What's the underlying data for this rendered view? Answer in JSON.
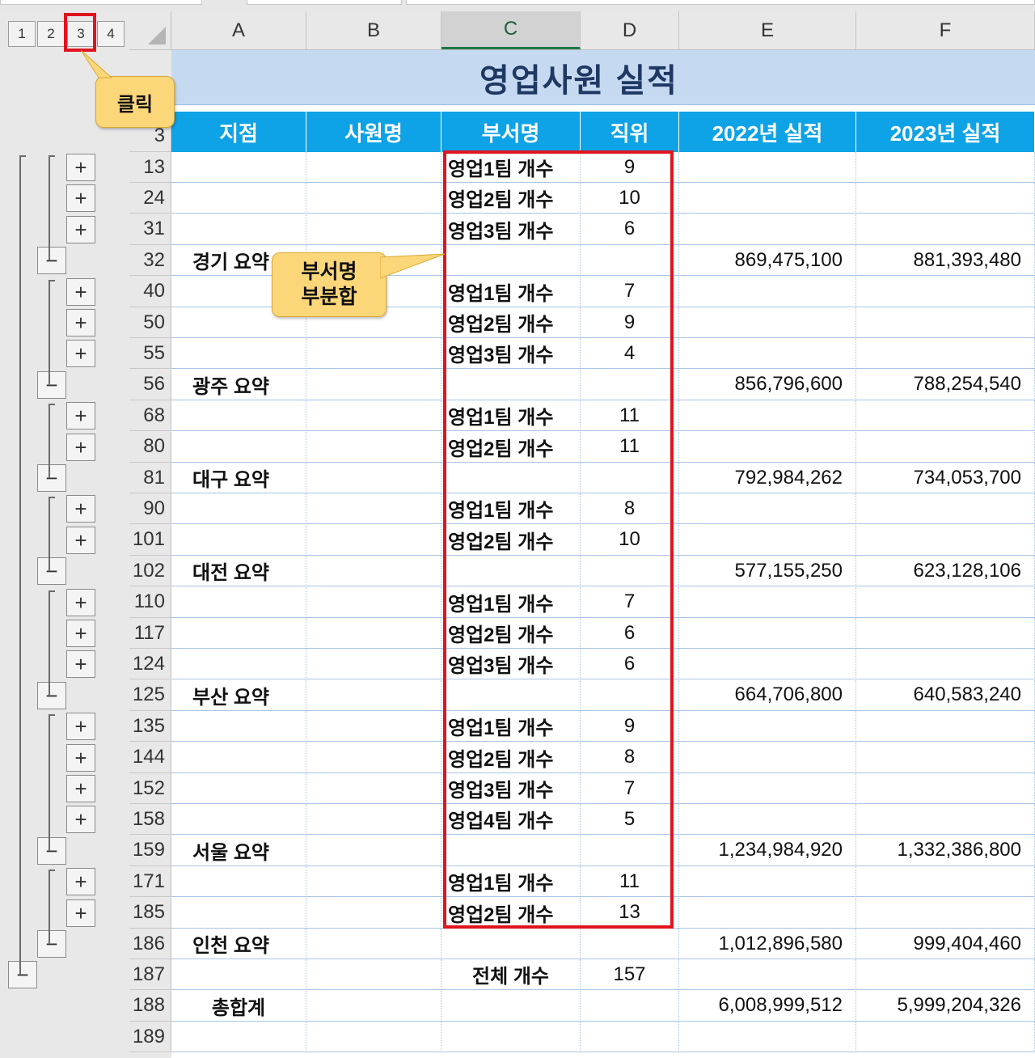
{
  "outline_levels": [
    "1",
    "2",
    "3",
    "4"
  ],
  "columns": [
    "A",
    "B",
    "C",
    "D",
    "E",
    "F"
  ],
  "selected_column": "C",
  "title": "영업사원 실적",
  "headers": [
    "지점",
    "사원명",
    "부서명",
    "직위",
    "2022년 실적",
    "2023년 실적"
  ],
  "callouts": {
    "click_label": "클릭",
    "subtotal_line1": "부서명",
    "subtotal_line2": "부분합"
  },
  "rows": [
    {
      "num": "3",
      "a": "",
      "c": "",
      "d": "",
      "e": "",
      "f": "",
      "type": "header"
    },
    {
      "num": "13",
      "a": "",
      "c": "영업1팀 개수",
      "d": "9",
      "e": "",
      "f": "",
      "type": "team"
    },
    {
      "num": "24",
      "a": "",
      "c": "영업2팀 개수",
      "d": "10",
      "e": "",
      "f": "",
      "type": "team"
    },
    {
      "num": "31",
      "a": "",
      "c": "영업3팀 개수",
      "d": "6",
      "e": "",
      "f": "",
      "type": "team"
    },
    {
      "num": "32",
      "a": "경기 요약",
      "c": "",
      "d": "",
      "e": "869,475,100",
      "f": "881,393,480",
      "type": "region"
    },
    {
      "num": "40",
      "a": "",
      "c": "영업1팀 개수",
      "d": "7",
      "e": "",
      "f": "",
      "type": "team"
    },
    {
      "num": "50",
      "a": "",
      "c": "영업2팀 개수",
      "d": "9",
      "e": "",
      "f": "",
      "type": "team"
    },
    {
      "num": "55",
      "a": "",
      "c": "영업3팀 개수",
      "d": "4",
      "e": "",
      "f": "",
      "type": "team"
    },
    {
      "num": "56",
      "a": "광주 요약",
      "c": "",
      "d": "",
      "e": "856,796,600",
      "f": "788,254,540",
      "type": "region"
    },
    {
      "num": "68",
      "a": "",
      "c": "영업1팀 개수",
      "d": "11",
      "e": "",
      "f": "",
      "type": "team"
    },
    {
      "num": "80",
      "a": "",
      "c": "영업2팀 개수",
      "d": "11",
      "e": "",
      "f": "",
      "type": "team"
    },
    {
      "num": "81",
      "a": "대구 요약",
      "c": "",
      "d": "",
      "e": "792,984,262",
      "f": "734,053,700",
      "type": "region"
    },
    {
      "num": "90",
      "a": "",
      "c": "영업1팀 개수",
      "d": "8",
      "e": "",
      "f": "",
      "type": "team"
    },
    {
      "num": "101",
      "a": "",
      "c": "영업2팀 개수",
      "d": "10",
      "e": "",
      "f": "",
      "type": "team"
    },
    {
      "num": "102",
      "a": "대전 요약",
      "c": "",
      "d": "",
      "e": "577,155,250",
      "f": "623,128,106",
      "type": "region"
    },
    {
      "num": "110",
      "a": "",
      "c": "영업1팀 개수",
      "d": "7",
      "e": "",
      "f": "",
      "type": "team"
    },
    {
      "num": "117",
      "a": "",
      "c": "영업2팀 개수",
      "d": "6",
      "e": "",
      "f": "",
      "type": "team"
    },
    {
      "num": "124",
      "a": "",
      "c": "영업3팀 개수",
      "d": "6",
      "e": "",
      "f": "",
      "type": "team"
    },
    {
      "num": "125",
      "a": "부산 요약",
      "c": "",
      "d": "",
      "e": "664,706,800",
      "f": "640,583,240",
      "type": "region"
    },
    {
      "num": "135",
      "a": "",
      "c": "영업1팀 개수",
      "d": "9",
      "e": "",
      "f": "",
      "type": "team"
    },
    {
      "num": "144",
      "a": "",
      "c": "영업2팀 개수",
      "d": "8",
      "e": "",
      "f": "",
      "type": "team"
    },
    {
      "num": "152",
      "a": "",
      "c": "영업3팀 개수",
      "d": "7",
      "e": "",
      "f": "",
      "type": "team"
    },
    {
      "num": "158",
      "a": "",
      "c": "영업4팀 개수",
      "d": "5",
      "e": "",
      "f": "",
      "type": "team"
    },
    {
      "num": "159",
      "a": "서울 요약",
      "c": "",
      "d": "",
      "e": "1,234,984,920",
      "f": "1,332,386,800",
      "type": "region"
    },
    {
      "num": "171",
      "a": "",
      "c": "영업1팀 개수",
      "d": "11",
      "e": "",
      "f": "",
      "type": "team"
    },
    {
      "num": "185",
      "a": "",
      "c": "영업2팀 개수",
      "d": "13",
      "e": "",
      "f": "",
      "type": "team"
    },
    {
      "num": "186",
      "a": "인천 요약",
      "c": "",
      "d": "",
      "e": "1,012,896,580",
      "f": "999,404,460",
      "type": "region"
    },
    {
      "num": "187",
      "a": "",
      "c": "전체 개수",
      "d": "157",
      "e": "",
      "f": "",
      "type": "grand_count"
    },
    {
      "num": "188",
      "a": "총합계",
      "c": "",
      "d": "",
      "e": "6,008,999,512",
      "f": "5,999,204,326",
      "type": "grand_total"
    },
    {
      "num": "189",
      "a": "",
      "c": "",
      "d": "",
      "e": "",
      "f": "",
      "type": "empty"
    }
  ]
}
